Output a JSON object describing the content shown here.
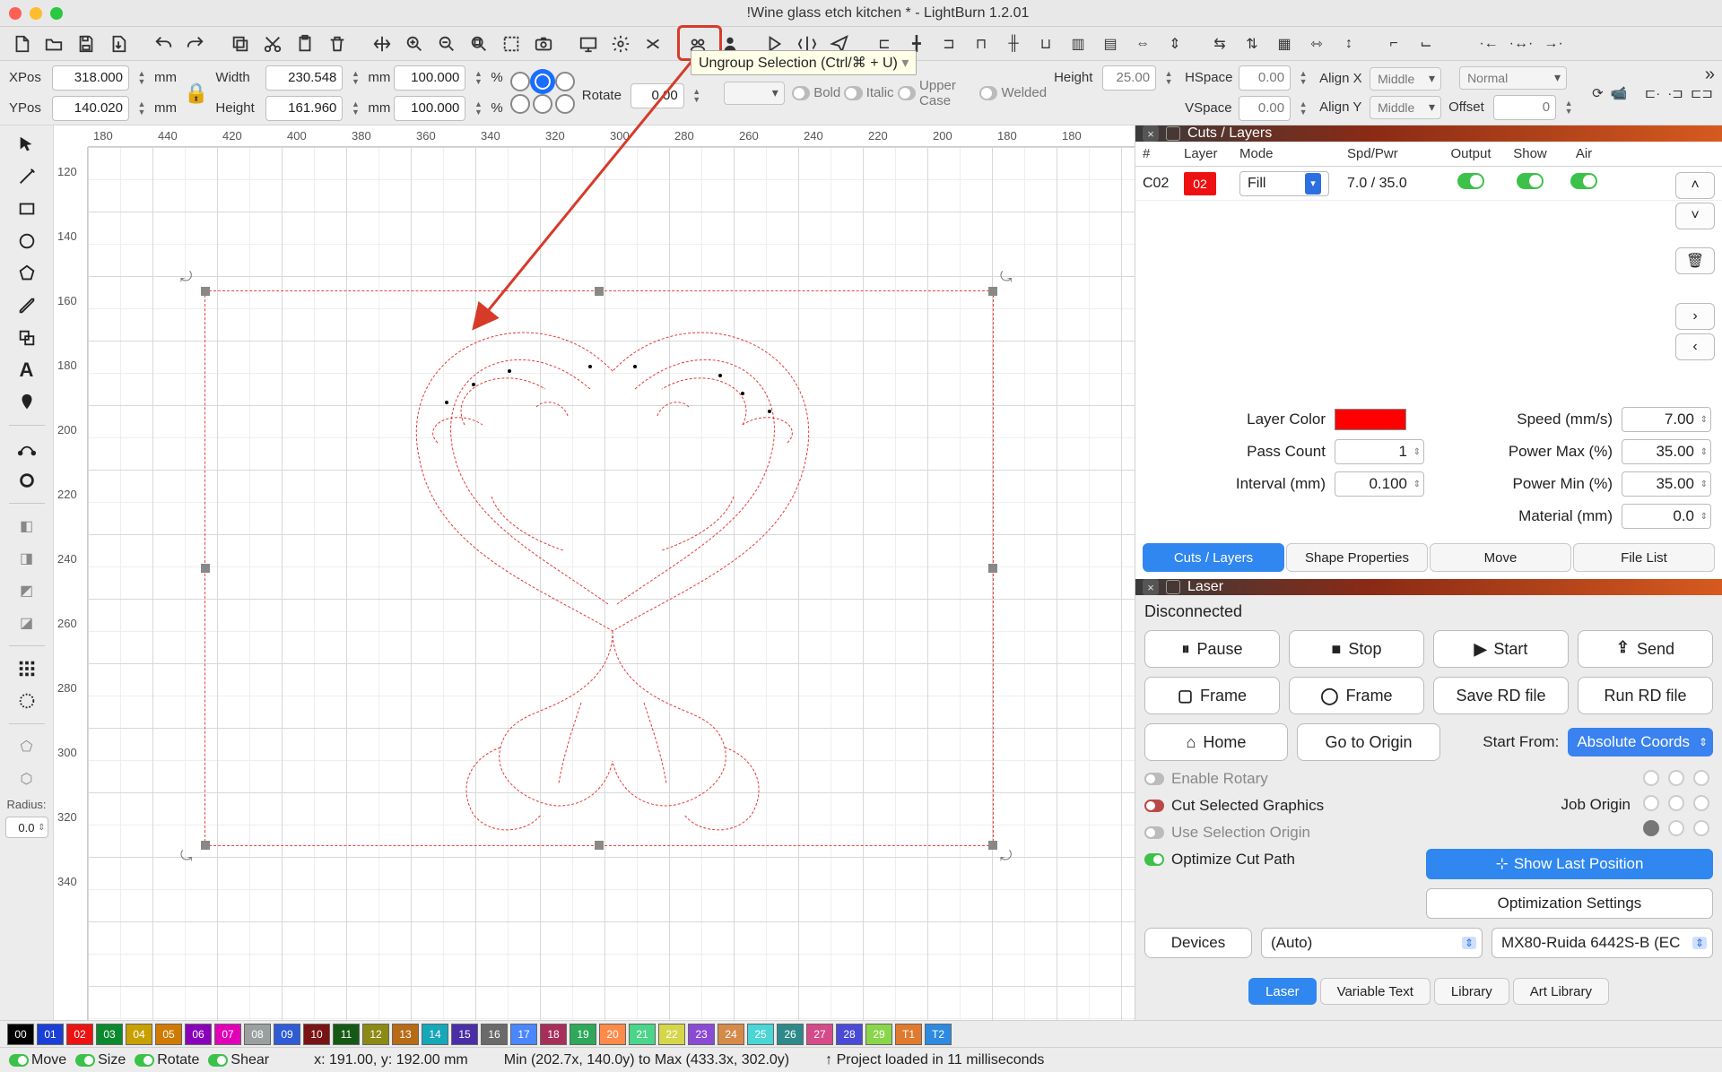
{
  "window": {
    "title": "!Wine glass etch kitchen * - LightBurn 1.2.01"
  },
  "tooltip": {
    "ungroup": "Ungroup Selection (Ctrl/⌘ + U)"
  },
  "props": {
    "xpos_label": "XPos",
    "xpos": "318.000",
    "xunit": "mm",
    "ypos_label": "YPos",
    "ypos": "140.020",
    "yunit": "mm",
    "width_label": "Width",
    "width": "230.548",
    "wunit": "mm",
    "wpct": "100.000",
    "wpctu": "%",
    "height_label": "Height",
    "height": "161.960",
    "hunit": "mm",
    "hpct": "100.000",
    "hpctu": "%",
    "rotate_label": "Rotate",
    "rotate": "0.00"
  },
  "text_props": {
    "height_label": "Height",
    "height": "25.00",
    "hspace_label": "HSpace",
    "hspace": "0.00",
    "vspace_label": "VSpace",
    "vspace": "0.00",
    "alignx_label": "Align X",
    "alignx": "Middle",
    "aligny_label": "Align Y",
    "aligny": "Middle",
    "offset_label": "Offset",
    "offset": "0",
    "mode": "Normal",
    "bold": "Bold",
    "italic": "Italic",
    "upper": "Upper Case",
    "welded": "Welded"
  },
  "left": {
    "radius_label": "Radius:",
    "radius": "0.0"
  },
  "ruler_h": [
    "180",
    "440",
    "420",
    "400",
    "380",
    "360",
    "340",
    "320",
    "300",
    "280",
    "260",
    "240",
    "220",
    "200",
    "180",
    "180"
  ],
  "ruler_v": [
    "120",
    "140",
    "160",
    "180",
    "200",
    "220",
    "240",
    "260",
    "280",
    "300",
    "320",
    "340"
  ],
  "cuts": {
    "title": "Cuts / Layers",
    "head": {
      "num": "#",
      "layer": "Layer",
      "mode": "Mode",
      "spd": "Spd/Pwr",
      "out": "Output",
      "show": "Show",
      "air": "Air"
    },
    "rows": [
      {
        "num": "C02",
        "layer": "02",
        "mode": "Fill",
        "spd": "7.0 / 35.0"
      }
    ],
    "detail": {
      "layer_color_label": "Layer Color",
      "speed_label": "Speed (mm/s)",
      "speed": "7.00",
      "pass_label": "Pass Count",
      "pass": "1",
      "pmax_label": "Power Max (%)",
      "pmax": "35.00",
      "interval_label": "Interval (mm)",
      "interval": "0.100",
      "pmin_label": "Power Min (%)",
      "pmin": "35.00",
      "material_label": "Material (mm)",
      "material": "0.0"
    },
    "tabs": [
      "Cuts / Layers",
      "Shape Properties",
      "Move",
      "File List"
    ]
  },
  "laser": {
    "title": "Laser",
    "status": "Disconnected",
    "pause": "Pause",
    "stop": "Stop",
    "start": "Start",
    "send": "Send",
    "frame1": "Frame",
    "frame2": "Frame",
    "saverd": "Save RD file",
    "runrd": "Run RD file",
    "home": "Home",
    "goto": "Go to Origin",
    "startfrom_label": "Start From:",
    "startfrom": "Absolute Coords",
    "joborigin_label": "Job Origin",
    "enable_rotary": "Enable Rotary",
    "cut_selected": "Cut Selected Graphics",
    "use_sel_origin": "Use Selection Origin",
    "opt_cut_path": "Optimize Cut Path",
    "show_last": "Show Last Position",
    "opt_settings": "Optimization Settings",
    "devices": "Devices",
    "port": "(Auto)",
    "controller": "MX80-Ruida 6442S-B (EC",
    "tabs": [
      "Laser",
      "Variable Text",
      "Library",
      "Art Library"
    ]
  },
  "palette": [
    {
      "l": "00",
      "c": "#000"
    },
    {
      "l": "01",
      "c": "#1a3fd6"
    },
    {
      "l": "02",
      "c": "#e11"
    },
    {
      "l": "03",
      "c": "#0a8a2e"
    },
    {
      "l": "04",
      "c": "#c8a000"
    },
    {
      "l": "05",
      "c": "#d07a00"
    },
    {
      "l": "06",
      "c": "#8a00b8"
    },
    {
      "l": "07",
      "c": "#e100b8"
    },
    {
      "l": "08",
      "c": "#9aa0a0"
    },
    {
      "l": "09",
      "c": "#2e5bd6"
    },
    {
      "l": "10",
      "c": "#7a1414"
    },
    {
      "l": "11",
      "c": "#145a14"
    },
    {
      "l": "12",
      "c": "#8a8a14"
    },
    {
      "l": "13",
      "c": "#b86a14"
    },
    {
      "l": "14",
      "c": "#14a8b8"
    },
    {
      "l": "15",
      "c": "#4a2ea8"
    },
    {
      "l": "16",
      "c": "#6a6a6a"
    },
    {
      "l": "17",
      "c": "#4a86ff"
    },
    {
      "l": "18",
      "c": "#a82e5a"
    },
    {
      "l": "19",
      "c": "#2ea85a"
    },
    {
      "l": "20",
      "c": "#ff8a4a"
    },
    {
      "l": "21",
      "c": "#4ad68a"
    },
    {
      "l": "22",
      "c": "#d6d64a"
    },
    {
      "l": "23",
      "c": "#8a4ad6"
    },
    {
      "l": "24",
      "c": "#d68a4a"
    },
    {
      "l": "25",
      "c": "#4ad6d6"
    },
    {
      "l": "26",
      "c": "#2e8a8a"
    },
    {
      "l": "27",
      "c": "#d64a8a"
    },
    {
      "l": "28",
      "c": "#4a4ad6"
    },
    {
      "l": "29",
      "c": "#8ad64a"
    },
    {
      "l": "T1",
      "c": "#e07a2e"
    },
    {
      "l": "T2",
      "c": "#2e8ae0"
    }
  ],
  "status": {
    "move": "Move",
    "size": "Size",
    "rotate": "Rotate",
    "shear": "Shear",
    "coords": "x: 191.00, y: 192.00 mm",
    "bounds": "Min (202.7x, 140.0y) to Max (433.3x, 302.0y)",
    "load": "↑ Project loaded in 11 milliseconds"
  }
}
